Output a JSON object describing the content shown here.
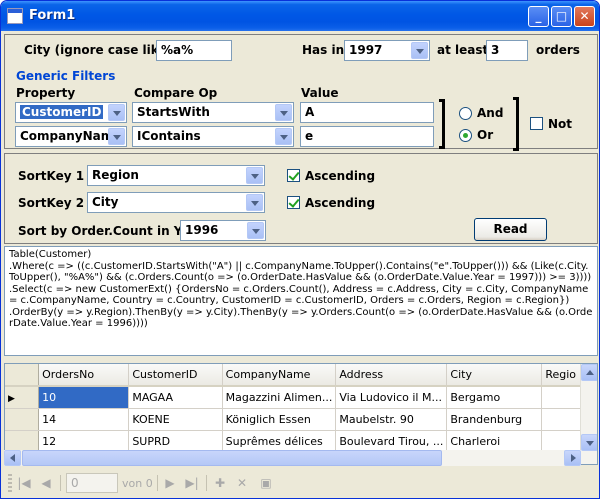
{
  "window": {
    "title": "Form1"
  },
  "top": {
    "city_label": "City (ignore case like)",
    "city_value": "%a%",
    "has_in_label": "Has in",
    "year_value": "1997",
    "at_least_label": "at least",
    "count_value": "3",
    "orders_label": "orders"
  },
  "filters": {
    "header": "Generic Filters",
    "property_header": "Property",
    "compare_header": "Compare Op",
    "value_header": "Value",
    "row1": {
      "property": "CustomerID",
      "op": "StartsWith",
      "value": "A"
    },
    "row2": {
      "property": "CompanyName",
      "op": "IContains",
      "value": "e"
    },
    "and_label": "And",
    "or_label": "Or",
    "not_label": "Not"
  },
  "sort": {
    "key1_label": "SortKey 1",
    "key1_value": "Region",
    "key2_label": "SortKey 2",
    "key2_value": "City",
    "ascending_label": "Ascending",
    "order_label": "Sort by Order.Count in Year",
    "order_year": "1996",
    "read_label": "Read"
  },
  "query_text": "Table(Customer)\n.Where(c => ((c.CustomerID.StartsWith(\"A\") || c.CompanyName.ToUpper().Contains(\"e\".ToUpper())) && (Like(c.City.ToUpper(), \"%A%\") && (c.Orders.Count(o => (o.OrderDate.HasValue && (o.OrderDate.Value.Year = 1997))) >= 3))))\n.Select(c => new CustomerExt() {OrdersNo = c.Orders.Count(), Address = c.Address, City = c.City, CompanyName = c.CompanyName, Country = c.Country, CustomerID = c.CustomerID, Orders = c.Orders, Region = c.Region})\n.OrderBy(y => y.Region).ThenBy(y => y.City).ThenBy(y => y.Orders.Count(o => (o.OrderDate.HasValue && (o.OrderDate.Value.Year = 1996))))",
  "grid": {
    "columns": [
      "OrdersNo",
      "CustomerID",
      "CompanyName",
      "Address",
      "City",
      "Regio"
    ],
    "rows": [
      [
        "10",
        "MAGAA",
        "Magazzini Alimen...",
        "Via Ludovico il M...",
        "Bergamo",
        ""
      ],
      [
        "14",
        "KOENE",
        "Königlich Essen",
        "Maubelstr. 90",
        "Brandenburg",
        ""
      ],
      [
        "12",
        "SUPRD",
        "Suprêmes délices",
        "Boulevard Tirou, ...",
        "Charleroi",
        ""
      ]
    ]
  },
  "navigator": {
    "position": "0",
    "count_text": "von 0"
  }
}
